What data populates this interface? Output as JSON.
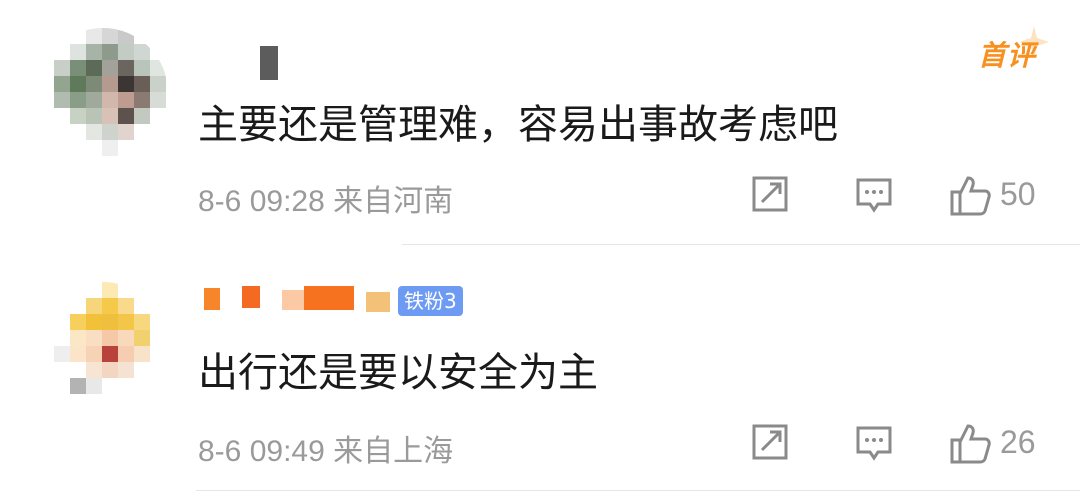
{
  "comments": [
    {
      "badge": "首评",
      "text": "主要还是管理难，容易出事故考虑吧",
      "meta": "8-6 09:28 来自河南",
      "likes": "50"
    },
    {
      "fan_badge": "铁粉3",
      "text": "出行还是要以安全为主",
      "meta": "8-6 09:49 来自上海",
      "likes": "26"
    }
  ],
  "icons": {
    "share": "share-icon",
    "reply": "reply-icon",
    "like": "thumbs-up-icon"
  },
  "colors": {
    "accent_orange": "#f7901e",
    "fan_badge_blue": "#6d9bf3",
    "meta_gray": "#9a9a9a",
    "text": "#1a1a1a"
  }
}
